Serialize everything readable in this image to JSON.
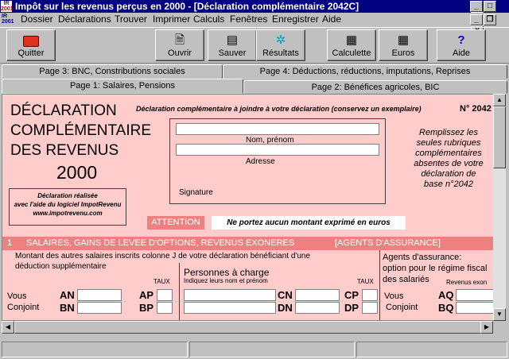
{
  "window": {
    "title": "Impôt sur les revenus perçus en 2000 - [Déclaration complémentaire 2042C]",
    "icon_text": "IR 2001",
    "controls": [
      "_",
      "\u0012",
      "×"
    ]
  },
  "menu": {
    "doc_icon_text": "IR 2001",
    "items": [
      "Dossier",
      "Déclarations",
      "Trouver",
      "Imprimer",
      "Calculs",
      "Fenêtres",
      "Enregistrer",
      "Aide"
    ],
    "controls": [
      "_",
      "\u0012",
      "×"
    ]
  },
  "toolbar": {
    "buttons": [
      {
        "label": "Quitter",
        "icon": "briefcase-icon"
      },
      {
        "label": "Ouvrir",
        "icon": "open-file-icon"
      },
      {
        "label": "Sauver",
        "icon": "save-icon"
      },
      {
        "label": "Résultats",
        "icon": "results-icon"
      },
      {
        "label": "Calculette",
        "icon": "calculator-icon"
      },
      {
        "label": "Euros",
        "icon": "euro-calculator-icon"
      },
      {
        "label": "Aide",
        "icon": "help-icon"
      }
    ]
  },
  "tabs": {
    "row1": [
      "Page 3: BNC, Constributions sociales",
      "Page 4: Déductions, réductions, imputations, Reprises"
    ],
    "row2": [
      "Page 1: Salaires, Pensions",
      "Page 2: Bénéfices agricoles, BIC"
    ],
    "active": "Page 1: Salaires, Pensions"
  },
  "form": {
    "title_lines": [
      "DÉCLARATION",
      "COMPLÉMENTAIRE",
      "DES REVENUS"
    ],
    "year": "2000",
    "header_note": "Déclaration complémentaire à joindre à votre déclaration (conservez un exemplaire)",
    "form_number": "N° 2042",
    "software_note": [
      "Déclaration réalisée",
      "avec l'aide du logiciel ImpotRevenu",
      "www.impotrevenu.com"
    ],
    "identity": {
      "nom_label": "Nom, prénom",
      "adresse_label": "Adresse",
      "signature_label": "Signature",
      "nom_value": "",
      "adresse_value": ""
    },
    "instructions": [
      "Remplissez les",
      "seules rubriques",
      "complémentaires",
      "absentes de votre",
      "déclaration de",
      "base n°2042"
    ],
    "attention_label": "ATTENTION",
    "attention_text": "Ne portez aucun montant exprimé en euros",
    "section1": {
      "number": "1",
      "title": "SALAIRES, GAINS DE LEVEE D'OPTIONS, REVENUS EXONERES",
      "title_right": "[AGENTS D'ASSURANCE]",
      "desc_line1": "Montant des autres salaires inscrits colonne J de votre déclaration bénéficiant d'une",
      "desc_line2": "déduction supplémentaire",
      "taux_label": "TAUX",
      "vous_label": "Vous",
      "conjoint_label": "Conjoint",
      "codes_left": [
        "AN",
        "BN"
      ],
      "codes_taux": [
        "AP",
        "BP"
      ],
      "personnes_title": "Personnes à charge",
      "personnes_sub": "Indiquez leurs nom et prénom",
      "taux_label2": "TAUX",
      "codes_pers": [
        "CN",
        "DN"
      ],
      "codes_pers_taux": [
        "CP",
        "DP"
      ],
      "agents_lines": [
        "Agents d'assurance:",
        "option pour le régime fiscal",
        "des salariés"
      ],
      "agents_rev": "Revenus exon",
      "codes_agents": [
        "AQ",
        "BQ"
      ]
    }
  },
  "colors": {
    "title_bar": "#000080",
    "form_bg": "#ffcccc",
    "section_bar": "#f08080",
    "attention_bg": "#f08080"
  }
}
